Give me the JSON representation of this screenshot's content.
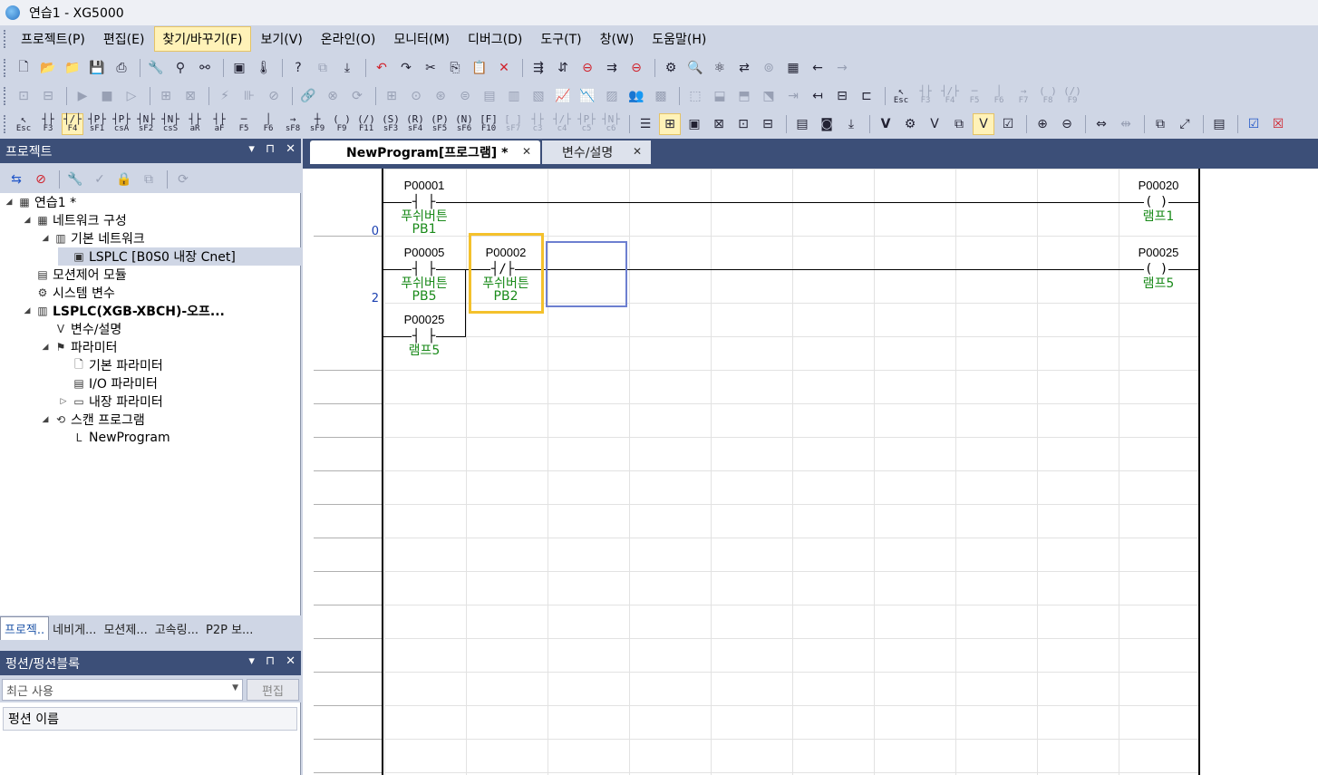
{
  "window": {
    "title": "연습1 - XG5000"
  },
  "menu": [
    "프로젝트(P)",
    "편집(E)",
    "찾기/바꾸기(F)",
    "보기(V)",
    "온라인(O)",
    "모니터(M)",
    "디버그(D)",
    "도구(T)",
    "창(W)",
    "도움말(H)"
  ],
  "menu_active_index": 2,
  "ladder_toolbar": [
    {
      "k": "Esc",
      "i": "↖"
    },
    {
      "k": "F3",
      "i": "┤├"
    },
    {
      "k": "F4",
      "i": "┤/├",
      "on": true
    },
    {
      "k": "sF1",
      "i": "┤P├"
    },
    {
      "k": "csA",
      "i": "┤P├"
    },
    {
      "k": "sF2",
      "i": "┤N├"
    },
    {
      "k": "csS",
      "i": "┤N├"
    },
    {
      "k": "aR",
      "i": "┤├"
    },
    {
      "k": "aF",
      "i": "┤├"
    },
    {
      "k": "F5",
      "i": "─"
    },
    {
      "k": "F6",
      "i": "│"
    },
    {
      "k": "sF8",
      "i": "→"
    },
    {
      "k": "sF9",
      "i": "┼"
    },
    {
      "k": "F9",
      "i": "( )"
    },
    {
      "k": "F11",
      "i": "(/)"
    },
    {
      "k": "sF3",
      "i": "(S)"
    },
    {
      "k": "sF4",
      "i": "(R)"
    },
    {
      "k": "sF5",
      "i": "(P)"
    },
    {
      "k": "sF6",
      "i": "(N)"
    },
    {
      "k": "F10",
      "i": "[F]"
    },
    {
      "k": "sF7",
      "i": "[ ]"
    },
    {
      "k": "c3",
      "i": "┤├"
    },
    {
      "k": "c4",
      "i": "┤/├"
    },
    {
      "k": "c5",
      "i": "┤P├"
    },
    {
      "k": "c6",
      "i": "┤N├"
    }
  ],
  "project_panel": {
    "title": "프로젝트",
    "tree": [
      {
        "label": "연습1 *",
        "level": 0,
        "exp": "◢",
        "icon": "project-icon"
      },
      {
        "label": "네트워크 구성",
        "level": 1,
        "exp": "◢",
        "icon": "network-config-icon"
      },
      {
        "label": "기본 네트워크",
        "level": 2,
        "exp": "◢",
        "icon": "network-icon"
      },
      {
        "label": "LSPLC [B0S0 내장 Cnet]",
        "level": 3,
        "exp": "",
        "icon": "cnet-icon",
        "selected": true
      },
      {
        "label": "모션제어 모듈",
        "level": 1,
        "exp": "",
        "icon": "motion-module-icon"
      },
      {
        "label": "시스템 변수",
        "level": 1,
        "exp": "",
        "icon": "system-variable-icon"
      },
      {
        "label": "LSPLC(XGB-XBCH)-오프...",
        "level": 1,
        "exp": "◢",
        "icon": "plc-icon",
        "bold": true
      },
      {
        "label": "변수/설명",
        "level": 2,
        "exp": "",
        "icon": "variable-icon"
      },
      {
        "label": "파라미터",
        "level": 2,
        "exp": "◢",
        "icon": "parameter-icon"
      },
      {
        "label": "기본 파라미터",
        "level": 3,
        "exp": "",
        "icon": "document-icon"
      },
      {
        "label": "I/O 파라미터",
        "level": 3,
        "exp": "",
        "icon": "io-icon"
      },
      {
        "label": "내장 파라미터",
        "level": 3,
        "exp": "▷",
        "icon": "embedded-icon"
      },
      {
        "label": "스캔 프로그램",
        "level": 2,
        "exp": "◢",
        "icon": "scan-program-icon"
      },
      {
        "label": "NewProgram",
        "level": 3,
        "exp": "",
        "icon": "ladder-program-icon"
      }
    ],
    "bottom_tabs": [
      "프로젝..",
      "네비게...",
      "모션제...",
      "고속링...",
      "P2P 보..."
    ]
  },
  "function_panel": {
    "title": "펑션/펑션블록",
    "filter": "최근 사용",
    "edit_label": "편집",
    "column": "펑션 이름"
  },
  "editor": {
    "tabs": [
      "NewProgram[프로그램] *",
      "변수/설명"
    ],
    "rung_numbers": [
      "0",
      "2"
    ],
    "elements": [
      {
        "addr": "P00001",
        "sym": "┤ ├",
        "cmt": "푸쉬버튼\nPB1"
      },
      {
        "addr": "P00020",
        "sym": "( )",
        "cmt": "램프1"
      },
      {
        "addr": "P00005",
        "sym": "┤ ├",
        "cmt": "푸쉬버튼\nPB5"
      },
      {
        "addr": "P00002",
        "sym": "┤/├",
        "cmt": "푸쉬버튼\nPB2"
      },
      {
        "addr": "P00025",
        "sym": "( )",
        "cmt": "램프5"
      },
      {
        "addr": "P00025",
        "sym": "┤ ├",
        "cmt": "램프5"
      }
    ]
  },
  "colors": {
    "panel_header": "#3c4f78",
    "chrome": "#cfd6e5",
    "comment_green": "#1a8a1a",
    "selection": "#f4c12c",
    "cursor": "#6d7fd0",
    "rung_number": "#1a3fb0"
  }
}
